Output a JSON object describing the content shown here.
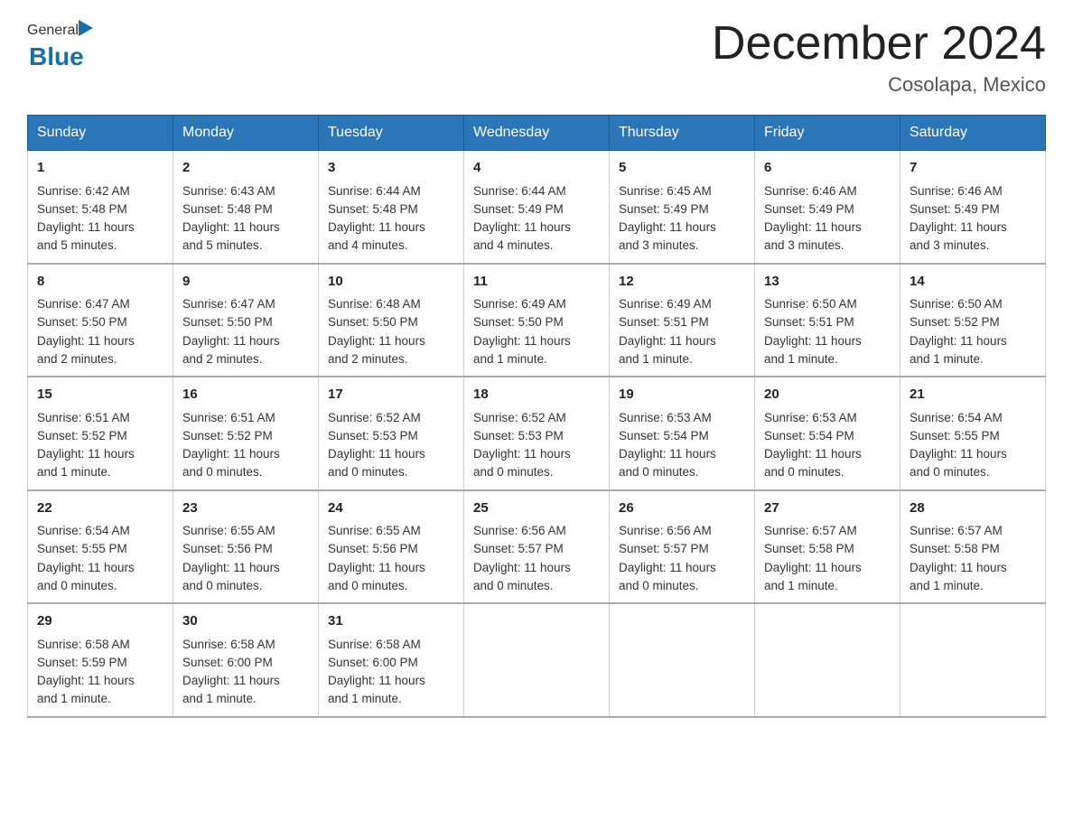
{
  "header": {
    "logo_general": "General",
    "logo_blue": "Blue",
    "month_year": "December 2024",
    "location": "Cosolapa, Mexico"
  },
  "days_of_week": [
    "Sunday",
    "Monday",
    "Tuesday",
    "Wednesday",
    "Thursday",
    "Friday",
    "Saturday"
  ],
  "weeks": [
    [
      {
        "day": "1",
        "sunrise": "6:42 AM",
        "sunset": "5:48 PM",
        "daylight": "11 hours and 5 minutes."
      },
      {
        "day": "2",
        "sunrise": "6:43 AM",
        "sunset": "5:48 PM",
        "daylight": "11 hours and 5 minutes."
      },
      {
        "day": "3",
        "sunrise": "6:44 AM",
        "sunset": "5:48 PM",
        "daylight": "11 hours and 4 minutes."
      },
      {
        "day": "4",
        "sunrise": "6:44 AM",
        "sunset": "5:49 PM",
        "daylight": "11 hours and 4 minutes."
      },
      {
        "day": "5",
        "sunrise": "6:45 AM",
        "sunset": "5:49 PM",
        "daylight": "11 hours and 3 minutes."
      },
      {
        "day": "6",
        "sunrise": "6:46 AM",
        "sunset": "5:49 PM",
        "daylight": "11 hours and 3 minutes."
      },
      {
        "day": "7",
        "sunrise": "6:46 AM",
        "sunset": "5:49 PM",
        "daylight": "11 hours and 3 minutes."
      }
    ],
    [
      {
        "day": "8",
        "sunrise": "6:47 AM",
        "sunset": "5:50 PM",
        "daylight": "11 hours and 2 minutes."
      },
      {
        "day": "9",
        "sunrise": "6:47 AM",
        "sunset": "5:50 PM",
        "daylight": "11 hours and 2 minutes."
      },
      {
        "day": "10",
        "sunrise": "6:48 AM",
        "sunset": "5:50 PM",
        "daylight": "11 hours and 2 minutes."
      },
      {
        "day": "11",
        "sunrise": "6:49 AM",
        "sunset": "5:50 PM",
        "daylight": "11 hours and 1 minute."
      },
      {
        "day": "12",
        "sunrise": "6:49 AM",
        "sunset": "5:51 PM",
        "daylight": "11 hours and 1 minute."
      },
      {
        "day": "13",
        "sunrise": "6:50 AM",
        "sunset": "5:51 PM",
        "daylight": "11 hours and 1 minute."
      },
      {
        "day": "14",
        "sunrise": "6:50 AM",
        "sunset": "5:52 PM",
        "daylight": "11 hours and 1 minute."
      }
    ],
    [
      {
        "day": "15",
        "sunrise": "6:51 AM",
        "sunset": "5:52 PM",
        "daylight": "11 hours and 1 minute."
      },
      {
        "day": "16",
        "sunrise": "6:51 AM",
        "sunset": "5:52 PM",
        "daylight": "11 hours and 0 minutes."
      },
      {
        "day": "17",
        "sunrise": "6:52 AM",
        "sunset": "5:53 PM",
        "daylight": "11 hours and 0 minutes."
      },
      {
        "day": "18",
        "sunrise": "6:52 AM",
        "sunset": "5:53 PM",
        "daylight": "11 hours and 0 minutes."
      },
      {
        "day": "19",
        "sunrise": "6:53 AM",
        "sunset": "5:54 PM",
        "daylight": "11 hours and 0 minutes."
      },
      {
        "day": "20",
        "sunrise": "6:53 AM",
        "sunset": "5:54 PM",
        "daylight": "11 hours and 0 minutes."
      },
      {
        "day": "21",
        "sunrise": "6:54 AM",
        "sunset": "5:55 PM",
        "daylight": "11 hours and 0 minutes."
      }
    ],
    [
      {
        "day": "22",
        "sunrise": "6:54 AM",
        "sunset": "5:55 PM",
        "daylight": "11 hours and 0 minutes."
      },
      {
        "day": "23",
        "sunrise": "6:55 AM",
        "sunset": "5:56 PM",
        "daylight": "11 hours and 0 minutes."
      },
      {
        "day": "24",
        "sunrise": "6:55 AM",
        "sunset": "5:56 PM",
        "daylight": "11 hours and 0 minutes."
      },
      {
        "day": "25",
        "sunrise": "6:56 AM",
        "sunset": "5:57 PM",
        "daylight": "11 hours and 0 minutes."
      },
      {
        "day": "26",
        "sunrise": "6:56 AM",
        "sunset": "5:57 PM",
        "daylight": "11 hours and 0 minutes."
      },
      {
        "day": "27",
        "sunrise": "6:57 AM",
        "sunset": "5:58 PM",
        "daylight": "11 hours and 1 minute."
      },
      {
        "day": "28",
        "sunrise": "6:57 AM",
        "sunset": "5:58 PM",
        "daylight": "11 hours and 1 minute."
      }
    ],
    [
      {
        "day": "29",
        "sunrise": "6:58 AM",
        "sunset": "5:59 PM",
        "daylight": "11 hours and 1 minute."
      },
      {
        "day": "30",
        "sunrise": "6:58 AM",
        "sunset": "6:00 PM",
        "daylight": "11 hours and 1 minute."
      },
      {
        "day": "31",
        "sunrise": "6:58 AM",
        "sunset": "6:00 PM",
        "daylight": "11 hours and 1 minute."
      },
      null,
      null,
      null,
      null
    ]
  ],
  "labels": {
    "sunrise": "Sunrise:",
    "sunset": "Sunset:",
    "daylight": "Daylight:"
  }
}
